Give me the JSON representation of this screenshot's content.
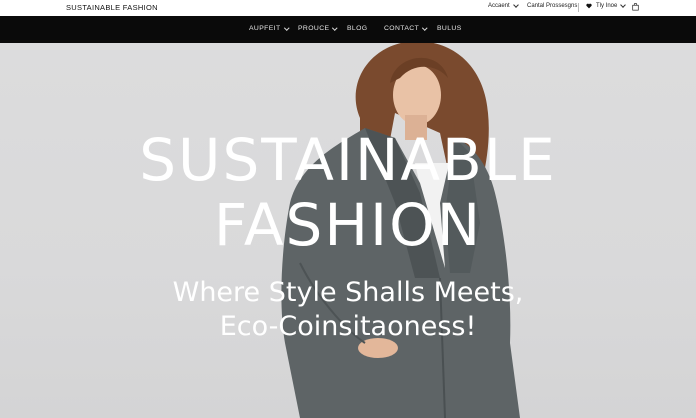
{
  "topbar": {
    "brand": "SUSTAINABLE FASHION",
    "account_label": "Accaent",
    "contact_label": "Cantal Prossesgns",
    "wishlist_label": "Tly Inoe"
  },
  "nav": {
    "items": [
      {
        "label": "AUPFEIT",
        "has_dropdown": true
      },
      {
        "label": "PROUCE",
        "has_dropdown": true
      },
      {
        "label": "BLOG",
        "has_dropdown": false
      },
      {
        "label": "CONTACT",
        "has_dropdown": true
      },
      {
        "label": "BULUS",
        "has_dropdown": false
      }
    ]
  },
  "hero": {
    "title_line1": "SUSTAINABLE",
    "title_line2": "FASHION",
    "subtitle_line1": "Where Style Shalls Meets,",
    "subtitle_line2": "Eco-Coinsitaoness!"
  },
  "colors": {
    "navbar_bg": "#0a0a0a",
    "hero_bg": "#d9d9da",
    "coat": "#5e6466",
    "hair": "#7a4a2e",
    "text_on_hero": "#ffffff"
  },
  "icons": {
    "account_chevron": "chevron-down-icon",
    "heart": "heart-icon",
    "bag": "shopping-bag-icon"
  }
}
